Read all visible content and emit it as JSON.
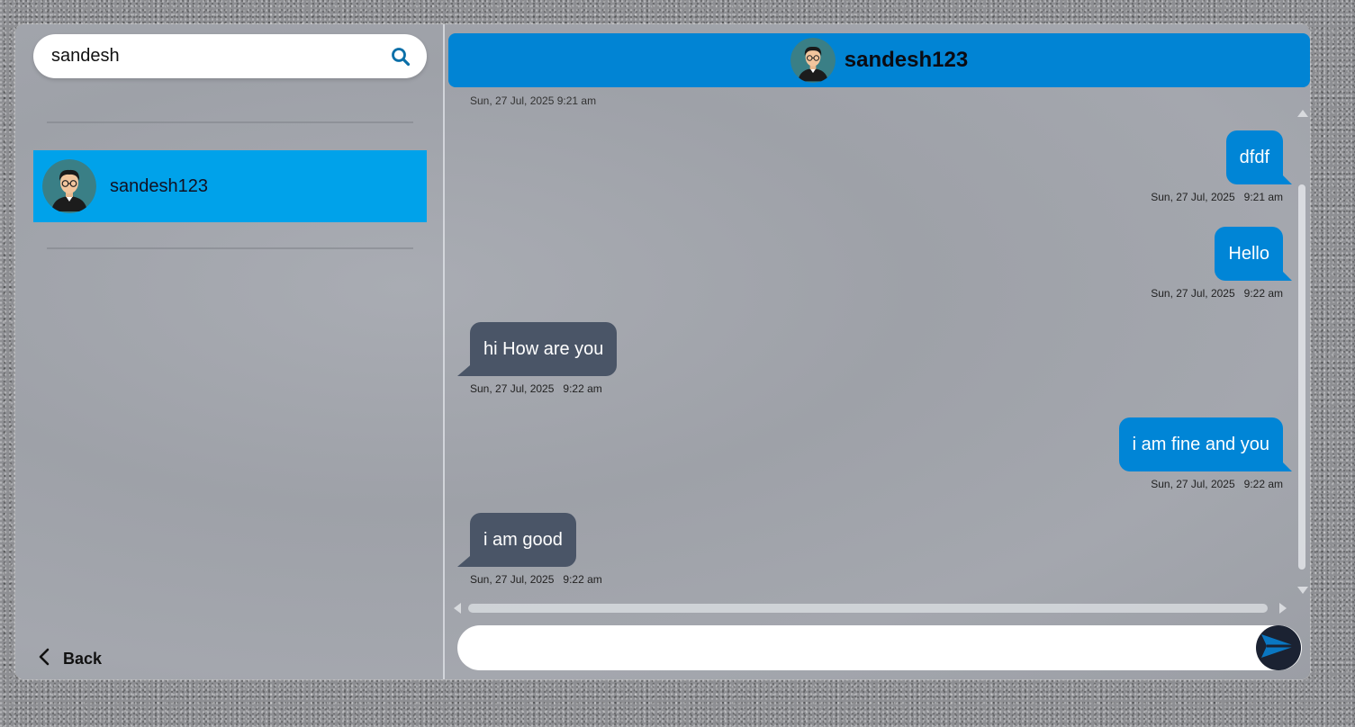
{
  "search": {
    "value": "sandesh"
  },
  "contacts": [
    {
      "name": "sandesh123"
    }
  ],
  "back": {
    "label": "Back"
  },
  "chat": {
    "name": "sandesh123",
    "cut_timestamp": "Sun, 27 Jul, 2025   9:21 am",
    "messages": [
      {
        "text": "dfdf",
        "direction": "out",
        "date": "Sun, 27 Jul, 2025",
        "time": "9:21 am"
      },
      {
        "text": "Hello",
        "direction": "out",
        "date": "Sun, 27 Jul, 2025",
        "time": "9:22 am"
      },
      {
        "text": "hi How are you",
        "direction": "in",
        "date": "Sun, 27 Jul, 2025",
        "time": "9:22 am"
      },
      {
        "text": "i am fine and you",
        "direction": "out",
        "date": "Sun, 27 Jul, 2025",
        "time": "9:22 am"
      },
      {
        "text": "i am good",
        "direction": "in",
        "date": "Sun, 27 Jul, 2025",
        "time": "9:22 am"
      }
    ]
  },
  "compose": {
    "value": ""
  },
  "colors": {
    "accent": "#0184d4",
    "contact_selected": "#00a2ea",
    "outgoing_bubble": "#0085d6",
    "incoming_bubble": "#4a5567",
    "send_button": "#1b2232"
  },
  "icons": {
    "search": "search-icon",
    "back": "chevron-left-icon",
    "send": "send-icon",
    "avatar": "avatar-icon"
  }
}
